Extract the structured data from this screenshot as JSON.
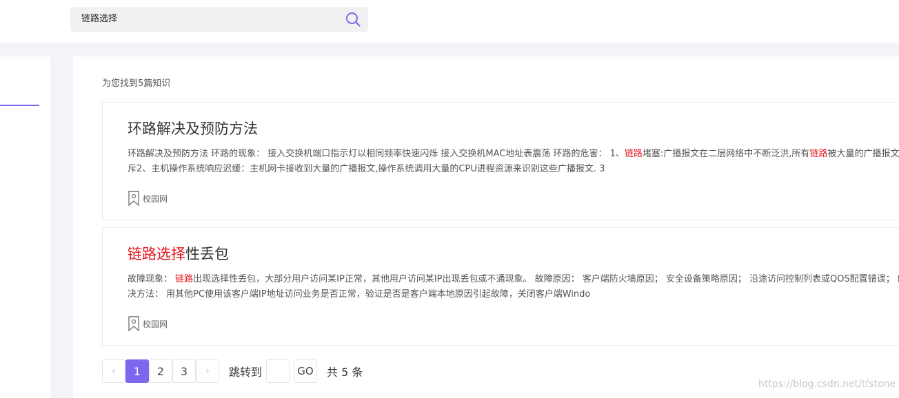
{
  "search": {
    "value": "链路选择",
    "icon": "search-icon",
    "accent": "#7b68ee"
  },
  "results": {
    "summary": "为您找到5篇知识",
    "cards": [
      {
        "title_plain": "环路解决及预防方法",
        "body_1": "环路解决及预防方法 环路的现象： 接入交换机端口指示灯以相同频率快速闪烁 接入交换机MAC地址表震荡 环路的危害： 1、",
        "body_hl_1": "链路",
        "body_2": "堵塞:广播报文在二层网络中不断泛洪,所有",
        "body_hl_2": "链路",
        "body_3": "被大量的广播报文充斥2、主机操作系统响应迟缓：主机网卡接收到大量的广播报文,操作系统调用大量的CPU进程资源来识别这些广播报文. 3",
        "tag": "校园网"
      },
      {
        "title_hl": "链路选择",
        "title_rest": "性丢包",
        "body_1": "故障现象： ",
        "body_hl_1": "链路",
        "body_2": "出现选择性丢包，大部分用户访问某IP正常，其他用户访问某IP出现丢包或不通现象。 故障原因： 客户端防火墙原因； 安全设备策略原因； 沿途访问控制列表或QOS配置错误； 解决方法： 用其他PC使用该客户端IP地址访问业务是否正常，验证是否是客户端本地原因引起故障，关闭客户端Windo",
        "tag": "校园网"
      }
    ]
  },
  "pagination": {
    "prev": "‹",
    "pages": [
      "1",
      "2",
      "3"
    ],
    "active": "1",
    "next": "›",
    "jump_label": "跳转到",
    "go_label": "GO",
    "total_label": "共 5 条"
  },
  "watermark": "https://blog.csdn.net/tfstone",
  "colors": {
    "highlight": "#e4141b",
    "accent": "#7b68ee"
  }
}
